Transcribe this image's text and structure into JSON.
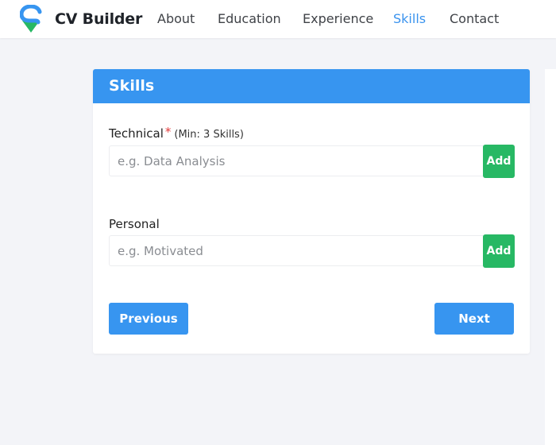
{
  "navbar": {
    "brand": "CV Builder",
    "links": [
      {
        "label": "About",
        "active": false
      },
      {
        "label": "Education",
        "active": false
      },
      {
        "label": "Experience",
        "active": false
      },
      {
        "label": "Skills",
        "active": true
      },
      {
        "label": "Contact",
        "active": false
      }
    ]
  },
  "skills_card": {
    "title": "Skills",
    "technical": {
      "label": "Technical",
      "required_marker": "*",
      "hint": "(Min: 3 Skills)",
      "placeholder": "e.g. Data Analysis",
      "value": "",
      "add_label": "Add"
    },
    "personal": {
      "label": "Personal",
      "placeholder": "e.g. Motivated",
      "value": "",
      "add_label": "Add"
    },
    "previous_label": "Previous",
    "next_label": "Next"
  },
  "colors": {
    "primary": "#3795f0",
    "success": "#27b864",
    "required": "#e23a3a",
    "background": "#f3f4f8"
  },
  "icons": {
    "brand_logo": "location-pin-logo-icon"
  }
}
